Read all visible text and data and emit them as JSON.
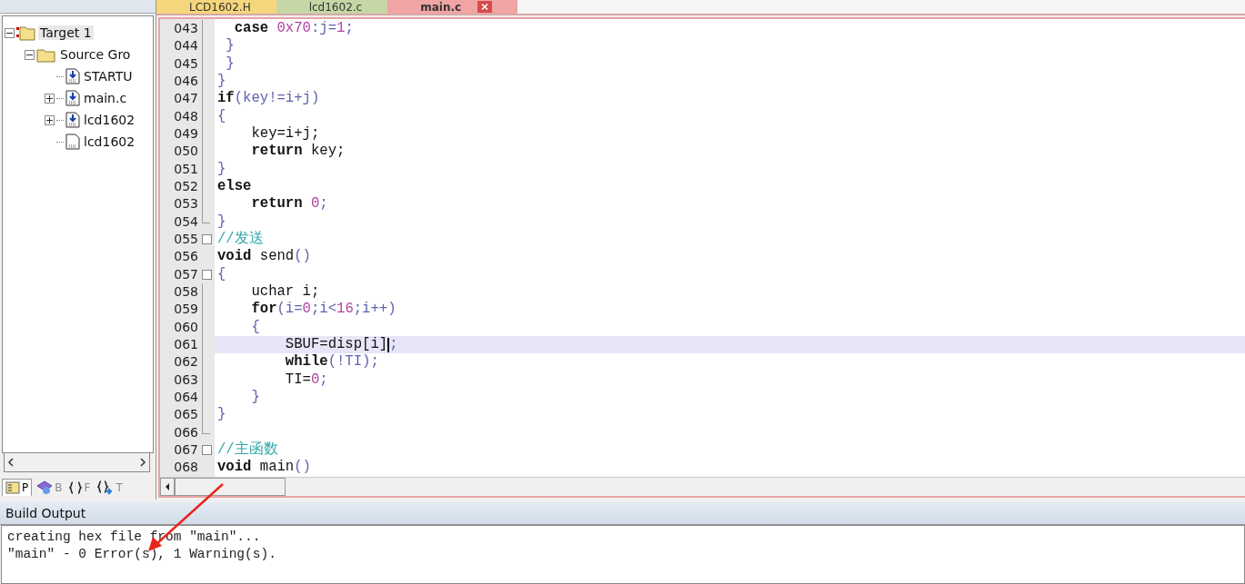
{
  "project_panel": {
    "tree": [
      {
        "label": "Target 1",
        "kind": "target",
        "expanded": true,
        "selected": true,
        "children": [
          {
            "label": "Source Gro",
            "kind": "folder",
            "expanded": true,
            "selected": false,
            "children": [
              {
                "label": "STARTU",
                "kind": "source",
                "selected": false
              },
              {
                "label": "main.c",
                "kind": "source",
                "expanded": false,
                "selected": false
              },
              {
                "label": "lcd1602",
                "kind": "source",
                "expanded": false,
                "selected": false
              },
              {
                "label": "lcd1602",
                "kind": "header",
                "selected": false
              }
            ]
          }
        ]
      }
    ],
    "tabs": [
      {
        "label": "P",
        "kind": "project",
        "selected": true
      },
      {
        "label": "B",
        "kind": "books",
        "selected": false
      },
      {
        "label": "F",
        "kind": "functions",
        "selected": false
      },
      {
        "label": "T",
        "kind": "templates",
        "selected": false
      }
    ]
  },
  "editor": {
    "tabs": [
      {
        "label": "LCD1602.H",
        "color": "#f6d67c",
        "selected": false
      },
      {
        "label": "lcd1602.c",
        "color": "#c6d7a6",
        "selected": false
      },
      {
        "label": "main.c",
        "color": "#f0a4a4",
        "selected": true
      }
    ],
    "lines": [
      {
        "number": "043",
        "kind": "folded",
        "current": false,
        "tokens": [
          {
            "kind": "keyword",
            "text": "  case"
          },
          {
            "kind": "number",
            "text": " 0x70"
          },
          {
            "kind": "operator",
            "text": ":j="
          },
          {
            "kind": "number",
            "text": "1"
          },
          {
            "kind": "operator",
            "text": ";"
          }
        ]
      },
      {
        "number": "044",
        "kind": "folded",
        "current": false,
        "tokens": [
          {
            "kind": "operator",
            "text": " }"
          }
        ]
      },
      {
        "number": "045",
        "kind": "folded",
        "current": false,
        "tokens": [
          {
            "kind": "operator",
            "text": " }"
          }
        ]
      },
      {
        "number": "046",
        "kind": "folded",
        "current": false,
        "tokens": [
          {
            "kind": "operator",
            "text": "}"
          }
        ]
      },
      {
        "number": "047",
        "kind": "folded",
        "current": false,
        "tokens": [
          {
            "kind": "keyword",
            "text": "if"
          },
          {
            "kind": "operator",
            "text": "(key!=i+j)"
          }
        ]
      },
      {
        "number": "048",
        "kind": "folded",
        "current": false,
        "tokens": [
          {
            "kind": "operator",
            "text": "{"
          }
        ]
      },
      {
        "number": "049",
        "kind": "folded",
        "current": false,
        "tokens": [
          {
            "kind": "plain",
            "text": "    key=i+j;"
          }
        ]
      },
      {
        "number": "050",
        "kind": "folded",
        "current": false,
        "tokens": [
          {
            "kind": "keyword",
            "text": "    return"
          },
          {
            "kind": "plain",
            "text": " key;"
          }
        ]
      },
      {
        "number": "051",
        "kind": "folded",
        "current": false,
        "tokens": [
          {
            "kind": "operator",
            "text": "}"
          }
        ]
      },
      {
        "number": "052",
        "kind": "folded",
        "current": false,
        "tokens": [
          {
            "kind": "keyword",
            "text": "else"
          }
        ]
      },
      {
        "number": "053",
        "kind": "folded",
        "current": false,
        "tokens": [
          {
            "kind": "keyword",
            "text": "    return"
          },
          {
            "kind": "number",
            "text": " 0"
          },
          {
            "kind": "operator",
            "text": ";"
          }
        ]
      },
      {
        "number": "054",
        "kind": "block_end",
        "current": false,
        "tokens": [
          {
            "kind": "operator",
            "text": "}"
          }
        ]
      },
      {
        "number": "055",
        "kind": "block_start",
        "current": false,
        "tokens": [
          {
            "kind": "comment",
            "text": "//发送"
          }
        ]
      },
      {
        "number": "056",
        "kind": "plain",
        "current": false,
        "tokens": [
          {
            "kind": "keyword",
            "text": "void"
          },
          {
            "kind": "plain",
            "text": " send"
          },
          {
            "kind": "operator",
            "text": "()"
          }
        ]
      },
      {
        "number": "057",
        "kind": "block_start",
        "current": false,
        "tokens": [
          {
            "kind": "operator",
            "text": "{"
          }
        ]
      },
      {
        "number": "058",
        "kind": "folded",
        "current": false,
        "tokens": [
          {
            "kind": "plain",
            "text": "    uchar i;"
          }
        ]
      },
      {
        "number": "059",
        "kind": "folded",
        "current": false,
        "tokens": [
          {
            "kind": "keyword",
            "text": "    for"
          },
          {
            "kind": "operator",
            "text": "(i="
          },
          {
            "kind": "number",
            "text": "0"
          },
          {
            "kind": "operator",
            "text": ";i<"
          },
          {
            "kind": "number",
            "text": "16"
          },
          {
            "kind": "operator",
            "text": ";i++)"
          }
        ]
      },
      {
        "number": "060",
        "kind": "folded",
        "current": false,
        "tokens": [
          {
            "kind": "operator",
            "text": "    {"
          }
        ]
      },
      {
        "number": "061",
        "kind": "folded",
        "current": true,
        "tokens": [
          {
            "kind": "plain",
            "text": "        SBUF=disp[i]"
          },
          {
            "kind": "operator",
            "text": ";",
            "caret_before": true
          }
        ]
      },
      {
        "number": "062",
        "kind": "folded",
        "current": false,
        "tokens": [
          {
            "kind": "keyword",
            "text": "        while"
          },
          {
            "kind": "operator",
            "text": "(!TI);"
          }
        ]
      },
      {
        "number": "063",
        "kind": "folded",
        "current": false,
        "tokens": [
          {
            "kind": "plain",
            "text": "        TI="
          },
          {
            "kind": "number",
            "text": "0"
          },
          {
            "kind": "operator",
            "text": ";"
          }
        ]
      },
      {
        "number": "064",
        "kind": "folded",
        "current": false,
        "tokens": [
          {
            "kind": "operator",
            "text": "    }"
          }
        ]
      },
      {
        "number": "065",
        "kind": "folded",
        "current": false,
        "tokens": [
          {
            "kind": "operator",
            "text": "}"
          }
        ]
      },
      {
        "number": "066",
        "kind": "block_end",
        "current": false
      },
      {
        "number": "067",
        "kind": "block_start",
        "current": false,
        "tokens": [
          {
            "kind": "comment",
            "text": "//主函数"
          }
        ]
      },
      {
        "number": "068",
        "kind": "plain",
        "current": false,
        "tokens": [
          {
            "kind": "keyword",
            "text": "void"
          },
          {
            "kind": "plain",
            "text": " main"
          },
          {
            "kind": "operator",
            "text": "()"
          }
        ]
      }
    ]
  },
  "build_output": {
    "title": "Build Output",
    "lines": [
      "creating hex file from \"main\"...",
      "\"main\" - 0 Error(s), 1 Warning(s)."
    ]
  }
}
